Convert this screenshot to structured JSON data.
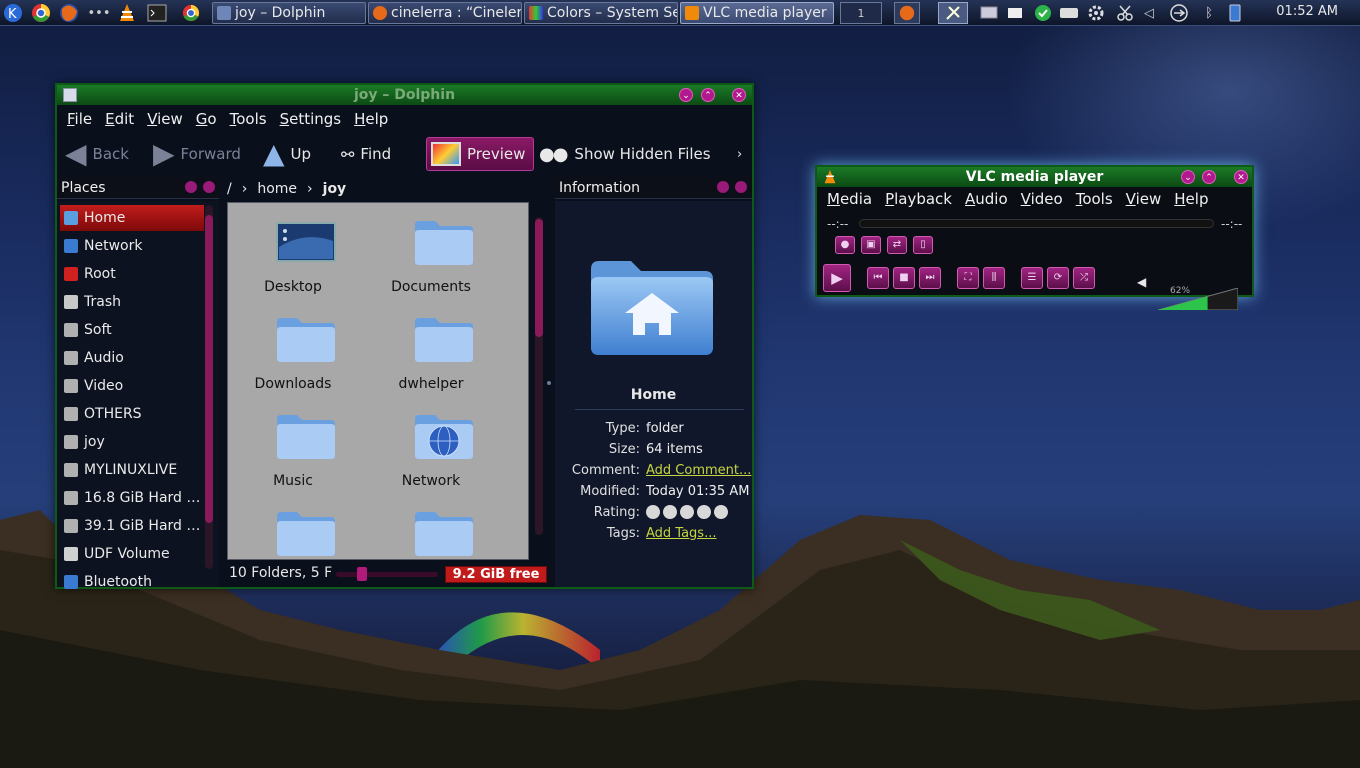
{
  "panel": {
    "tasks": [
      {
        "label": "joy – Dolphin"
      },
      {
        "label": "cinelerra : “Cinelerra"
      },
      {
        "label": "Colors – System Se"
      },
      {
        "label": "VLC media player"
      }
    ],
    "pager": "1",
    "clock": "01:52 AM"
  },
  "dolphin": {
    "title": "joy – Dolphin",
    "menu": [
      "File",
      "Edit",
      "View",
      "Go",
      "Tools",
      "Settings",
      "Help"
    ],
    "toolbar": {
      "back": "Back",
      "forward": "Forward",
      "up": "Up",
      "find": "Find",
      "preview": "Preview",
      "hidden": "Show Hidden Files"
    },
    "places_title": "Places",
    "places": [
      {
        "label": "Home",
        "icon": "home-icon",
        "color": "#5aa0e0"
      },
      {
        "label": "Network",
        "icon": "network-icon",
        "color": "#3a7ad0"
      },
      {
        "label": "Root",
        "icon": "folder-red-icon",
        "color": "#d02020"
      },
      {
        "label": "Trash",
        "icon": "trash-icon",
        "color": "#c8c8c8"
      },
      {
        "label": "Soft",
        "icon": "drive-icon",
        "color": "#b0b0b0"
      },
      {
        "label": "Audio",
        "icon": "drive-icon",
        "color": "#b0b0b0"
      },
      {
        "label": "Video",
        "icon": "drive-icon",
        "color": "#b0b0b0"
      },
      {
        "label": "OTHERS",
        "icon": "drive-icon",
        "color": "#b0b0b0"
      },
      {
        "label": "joy",
        "icon": "drive-icon",
        "color": "#b0b0b0"
      },
      {
        "label": "MYLINUXLIVE",
        "icon": "usb-drive-icon",
        "color": "#b0b0b0"
      },
      {
        "label": "16.8 GiB Hard …",
        "icon": "drive-icon",
        "color": "#b0b0b0"
      },
      {
        "label": "39.1 GiB Hard …",
        "icon": "drive-icon",
        "color": "#b0b0b0"
      },
      {
        "label": "UDF Volume",
        "icon": "disc-icon",
        "color": "#d0d0d0"
      },
      {
        "label": "Bluetooth",
        "icon": "bluetooth-icon",
        "color": "#3a7ad0"
      }
    ],
    "breadcrumb": {
      "root": "/",
      "home": "home",
      "current": "joy"
    },
    "files": [
      {
        "label": "Desktop"
      },
      {
        "label": "Documents"
      },
      {
        "label": "Downloads"
      },
      {
        "label": "dwhelper"
      },
      {
        "label": "Music"
      },
      {
        "label": "Network"
      }
    ],
    "status": {
      "summary": "10 Folders, 5 F",
      "free": "9.2 GiB free",
      "free_fraction": 1.0
    },
    "info": {
      "header": "Information",
      "title": "Home",
      "rows": [
        {
          "k": "Type:",
          "v": "folder"
        },
        {
          "k": "Size:",
          "v": "64 items"
        },
        {
          "k": "Comment:",
          "v": "Add Comment..."
        },
        {
          "k": "Modified:",
          "v": "Today 01:35 AM"
        },
        {
          "k": "Rating:",
          "v": ""
        },
        {
          "k": "Tags:",
          "v": "Add Tags..."
        }
      ]
    }
  },
  "vlc": {
    "title": "VLC media player",
    "menu": [
      "Media",
      "Playback",
      "Audio",
      "Video",
      "Tools",
      "View",
      "Help"
    ],
    "time_left": "--:--",
    "time_right": "--:--",
    "volume": "62%",
    "volume_fraction": 0.62
  }
}
